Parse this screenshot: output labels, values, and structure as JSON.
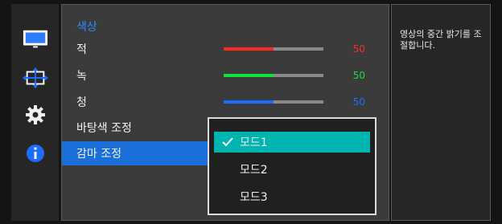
{
  "menu": {
    "title": "색상",
    "items": [
      {
        "label": "적",
        "value": "50",
        "color": "#ff2a1f"
      },
      {
        "label": "녹",
        "value": "50",
        "color": "#10e23b"
      },
      {
        "label": "청",
        "value": "50",
        "color": "#1e6bff"
      }
    ],
    "background_color_adjust": "바탕색 조정",
    "gamma_adjust": "감마 조정"
  },
  "dropdown": {
    "options": [
      "모드1",
      "모드2",
      "모드3"
    ],
    "selected": "모드1"
  },
  "help_text": "영상의 중간 밝기를 조절합니다.",
  "sidebar": {
    "icons": [
      "monitor-icon",
      "resize-arrows-icon",
      "gear-icon",
      "info-icon"
    ]
  }
}
